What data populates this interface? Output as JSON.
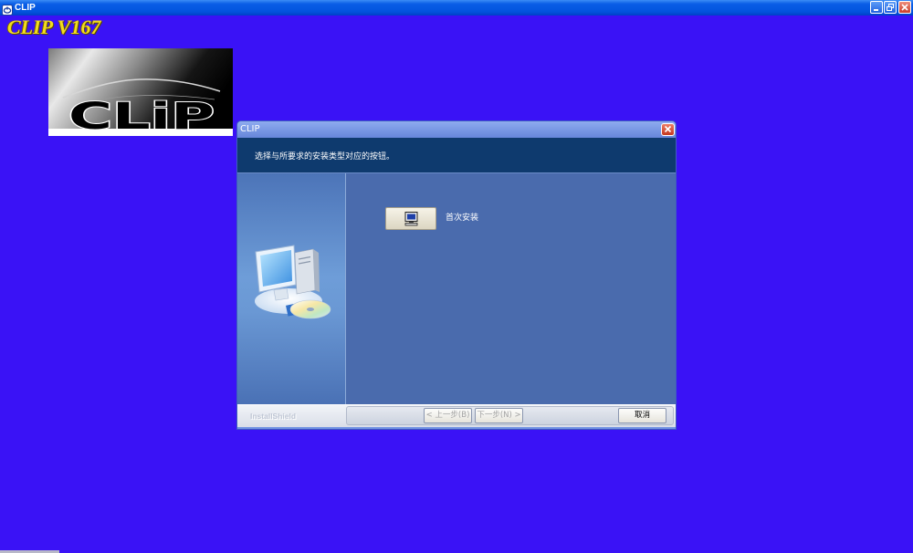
{
  "window": {
    "title": "CLIP",
    "icon": "clip-app-icon",
    "controls": {
      "minimize": "minimize-icon",
      "restore": "restore-icon",
      "close": "close-icon"
    }
  },
  "app_title": "CLIP V167",
  "logo": {
    "text": "CLiP"
  },
  "dialog": {
    "title": "CLIP",
    "instruction": "选择与所要求的安装类型对应的按钮。",
    "side_image": "computer-setup-icon",
    "setup_types": [
      {
        "label": "首次安装",
        "icon": "computer-icon"
      }
    ],
    "brand": "InstallShield",
    "buttons": {
      "back": {
        "label": "< 上一步(B)",
        "enabled": false
      },
      "next": {
        "label": "下一步(N) >",
        "enabled": false
      },
      "cancel": {
        "label": "取消",
        "enabled": true
      }
    }
  },
  "colors": {
    "desktop_background": "#3A12F6",
    "app_title": "#F2DC1E",
    "header_background": "#0E3A6E",
    "panel_background": "#4A6BAD"
  }
}
